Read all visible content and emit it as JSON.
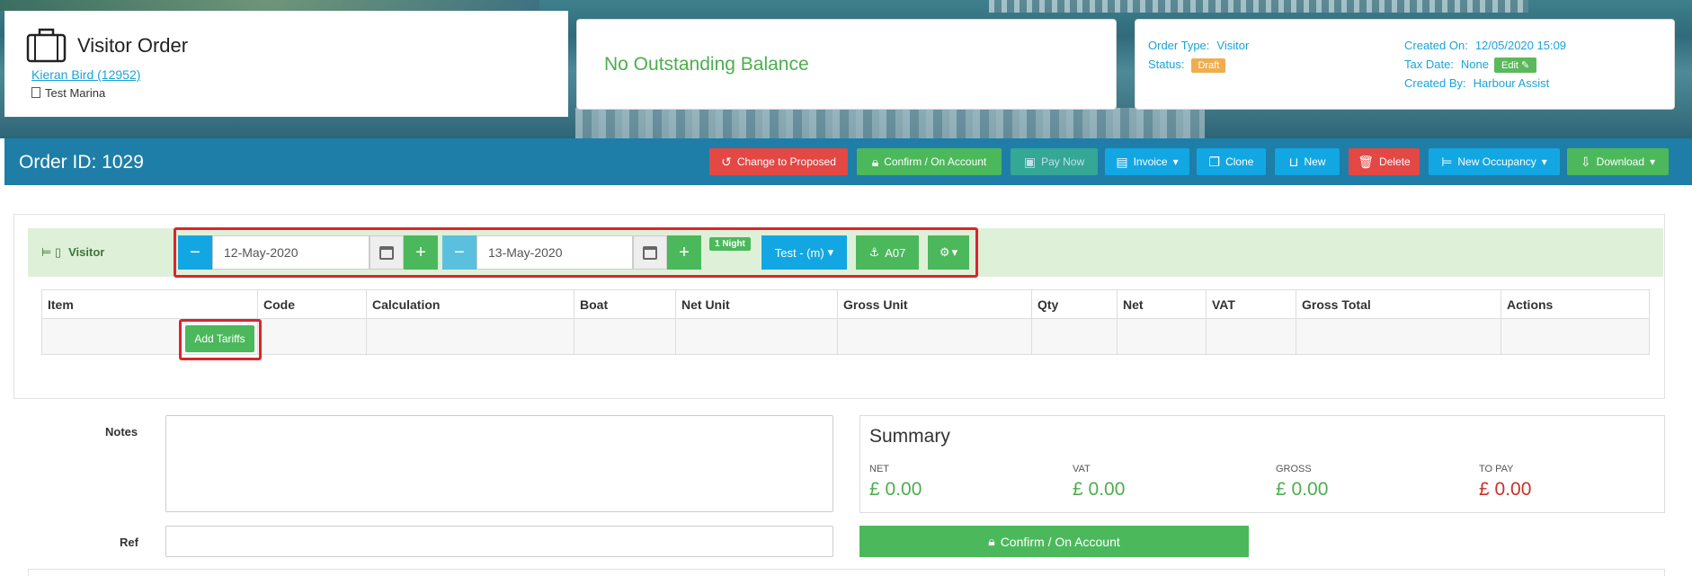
{
  "order": {
    "title": "Visitor Order",
    "customer": "Kieran Bird (12952)",
    "marina": "Test Marina",
    "balance": "No Outstanding Balance",
    "id_label": "Order ID: 1029"
  },
  "info": {
    "order_type_label": "Order Type:",
    "order_type": "Visitor",
    "status_label": "Status:",
    "status": "Draft",
    "created_on_label": "Created On:",
    "created_on": "12/05/2020 15:09",
    "tax_date_label": "Tax Date:",
    "tax_date": "None",
    "edit_label": "Edit",
    "created_by_label": "Created By:",
    "created_by": "Harbour Assist"
  },
  "toolbar": {
    "change": "Change to Proposed",
    "confirm": "Confirm / On Account",
    "pay": "Pay Now",
    "invoice": "Invoice",
    "clone": "Clone",
    "new": "New",
    "delete": "Delete",
    "occupancy": "New Occupancy",
    "download": "Download"
  },
  "occupancy": {
    "label": "Visitor",
    "start_date": "12-May-2020",
    "end_date": "13-May-2020",
    "nights": "1 Night",
    "boat": "Test - (m)",
    "berth": "A07"
  },
  "table": {
    "headers": [
      "Item",
      "Code",
      "Calculation",
      "Boat",
      "Net Unit",
      "Gross Unit",
      "Qty",
      "Net",
      "VAT",
      "Gross Total",
      "Actions"
    ],
    "add_tariffs": "Add Tariffs"
  },
  "form": {
    "notes_label": "Notes",
    "ref_label": "Ref"
  },
  "summary": {
    "title": "Summary",
    "net_label": "NET",
    "net": "£ 0.00",
    "vat_label": "VAT",
    "vat": "£ 0.00",
    "gross_label": "GROSS",
    "gross": "£ 0.00",
    "topay_label": "TO PAY",
    "topay": "£ 0.00",
    "confirm": "Confirm / On Account"
  },
  "colors": {
    "header_bar": "#1e7ea8",
    "success": "#4cb85c",
    "danger": "#e34845",
    "info": "#12a7e2",
    "highlight_box": "#d9262c"
  }
}
